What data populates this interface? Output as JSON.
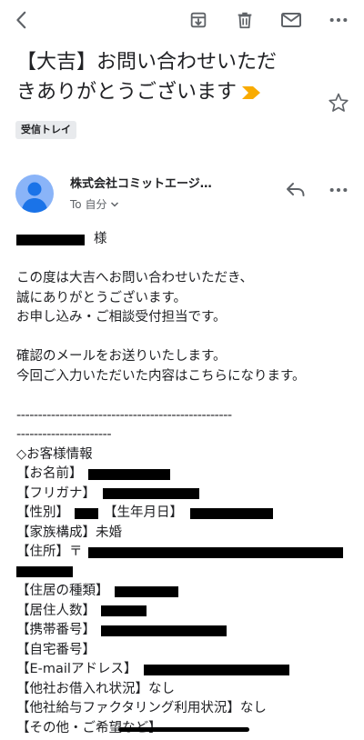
{
  "toolbar": {
    "back_icon": "arrow-back-icon",
    "archive_icon": "archive-icon",
    "delete_icon": "trash-icon",
    "mark_unread_icon": "mail-icon",
    "more_icon": "more-dots-icon"
  },
  "email": {
    "subject_line1": "【大吉】お問い合わせいただ",
    "subject_line2": "きありがとうございます",
    "label": "受信トレイ",
    "sender": "株式会社コミットエージ…",
    "to": "To 自分",
    "body": {
      "salutation": "様",
      "p1": [
        "この度は大吉へお問い合わせいただき、",
        "誠にありがとうございます。",
        "お申し込み・ご相談受付担当です。"
      ],
      "p2": [
        "確認のメールをお送りいたします。",
        "今回ご入力いただいた内容はこちらになります。"
      ],
      "separator1": "--------------------------------------------------",
      "separator2": "----------------------",
      "section_title": "◇お客様情報",
      "name_label": "【お名前】",
      "furigana_label": "【フリガナ】",
      "gender_label": "【性別】",
      "birthday_label": "【生年月日】",
      "family_label": "【家族構成】未婚",
      "address_label": "【住所】〒",
      "residence_type_label": "【住居の種類】",
      "residents_label": "【居住人数】",
      "mobile_label": "【携帯番号】",
      "home_phone_label": "【自宅番号】",
      "email_label": "【E-mailアドレス】",
      "other_loans": "【他社お借入れ状況】なし",
      "factoring": "【他社給与ファクタリング利用状況】なし",
      "other": "【その他・ご希望など】"
    }
  },
  "colors": {
    "importance_marker": "#f9ab00",
    "avatar_bg": "#8ab4f8",
    "avatar_fg": "#1a73e8"
  }
}
